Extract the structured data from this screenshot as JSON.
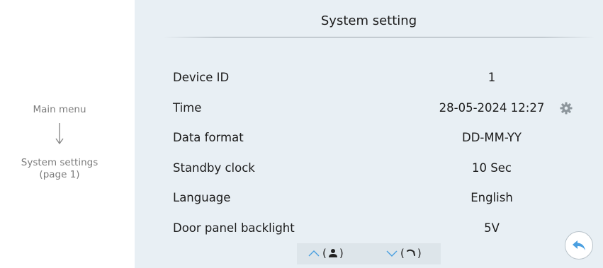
{
  "left_panel": {
    "main_menu": "Main menu",
    "system_settings_line1": "System settings",
    "system_settings_line2": "(page 1)"
  },
  "screen": {
    "title": "System setting",
    "rows": [
      {
        "label": "Device ID",
        "value": "1"
      },
      {
        "label": "Time",
        "value": "28-05-2024 12:27"
      },
      {
        "label": "Data format",
        "value": "DD-MM-YY"
      },
      {
        "label": "Standby clock",
        "value": "10 Sec"
      },
      {
        "label": "Language",
        "value": "English"
      },
      {
        "label": "Door panel backlight",
        "value": "5V"
      }
    ],
    "nav": {
      "up_open": "(",
      "up_close": ")",
      "down_open": "(",
      "down_close": ")"
    }
  },
  "colors": {
    "panel_bg": "#e8eff4",
    "accent_blue": "#4a9fe0",
    "caption_gray": "#7d7d7d"
  }
}
